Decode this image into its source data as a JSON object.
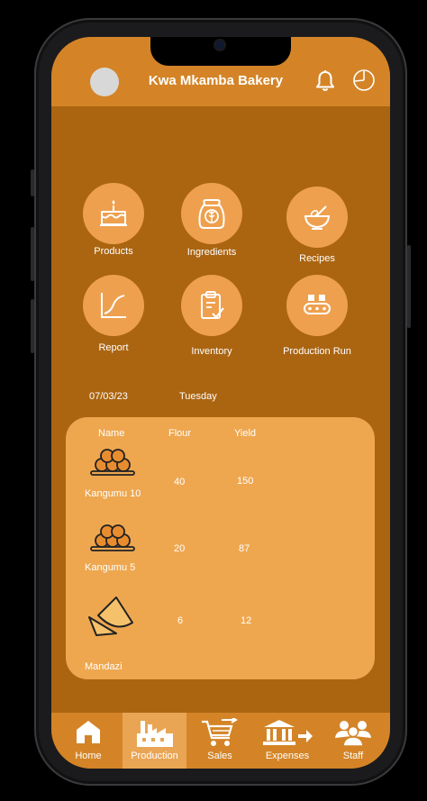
{
  "header": {
    "title": "Kwa Mkamba Bakery"
  },
  "menu": {
    "products": "Products",
    "ingredients": "Ingredients",
    "recipes": "Recipes",
    "report": "Report",
    "inventory": "Inventory",
    "production_run": "Production Run"
  },
  "summary": {
    "date": "07/03/23",
    "day": "Tuesday"
  },
  "table": {
    "headers": [
      "Name",
      "Flour",
      "Yield"
    ],
    "rows": [
      {
        "name": "Kangumu 10",
        "flour": "40",
        "yield": "150"
      },
      {
        "name": "Kangumu 5",
        "flour": "20",
        "yield": "87"
      },
      {
        "name": "Mandazi",
        "flour": "6",
        "yield": "12"
      }
    ]
  },
  "tabs": {
    "home": "Home",
    "production": "Production",
    "sales": "Sales",
    "expenses": "Expenses",
    "staff": "Staff"
  },
  "colors": {
    "header": "#d48427",
    "background": "#ab6511",
    "tile": "#eea04e",
    "panel": "#eea74f",
    "active_tab": "#eaa554"
  },
  "icons": [
    "bell-icon",
    "clock-icon",
    "cake-icon",
    "flour-sack-icon",
    "mixing-bowl-icon",
    "line-chart-icon",
    "clipboard-check-icon",
    "conveyor-icon",
    "home-icon",
    "factory-icon",
    "cart-icon",
    "bank-icon",
    "people-icon"
  ]
}
